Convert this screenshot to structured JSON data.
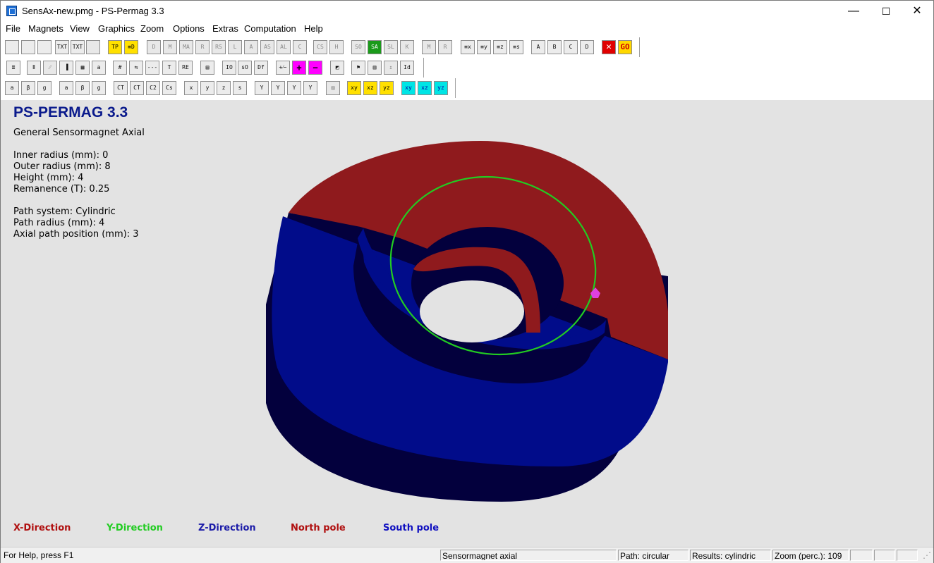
{
  "window": {
    "title": "SensAx-new.pmg - PS-Permag 3.3",
    "minimize": "—",
    "maximize": "☐",
    "close": "✕"
  },
  "menu": [
    "File",
    "Magnets",
    "View",
    "Graphics",
    "Zoom",
    "Options",
    "Extras",
    "Computation",
    "Help"
  ],
  "toolbar": {
    "row1": [
      {
        "name": "new-file-button",
        "label": "",
        "icon": "new-document-icon"
      },
      {
        "name": "open-file-button",
        "label": "",
        "icon": "open-folder-icon"
      },
      {
        "name": "save-file-button",
        "label": "",
        "icon": "floppy-disk-icon"
      },
      {
        "name": "export-txt-button",
        "label": "TXT"
      },
      {
        "name": "export-txt-graph-button",
        "label": "TXT"
      },
      {
        "name": "print-button",
        "label": "",
        "icon": "printer-icon"
      },
      {
        "name": "tp-button",
        "label": "TP"
      },
      {
        "name": "yellow-list-button",
        "label": "≡D"
      },
      {
        "name": "3d-d-button",
        "label": "D"
      },
      {
        "name": "3d-m-button",
        "label": "M"
      },
      {
        "name": "3d-ma-button",
        "label": "MA"
      },
      {
        "name": "3d-r-button",
        "label": "R"
      },
      {
        "name": "3d-rs-button",
        "label": "RS"
      },
      {
        "name": "3d-l-button",
        "label": "L"
      },
      {
        "name": "3d-a-button",
        "label": "A"
      },
      {
        "name": "3d-as-button",
        "label": "AS"
      },
      {
        "name": "3d-al-button",
        "label": "AL"
      },
      {
        "name": "3d-c-button",
        "label": "C"
      },
      {
        "name": "3d-cs-button",
        "label": "CS"
      },
      {
        "name": "3d-h-button",
        "label": "H"
      },
      {
        "name": "3d-so-button",
        "label": "SO"
      },
      {
        "name": "3d-sa-button",
        "label": "SA"
      },
      {
        "name": "3d-sl-button",
        "label": "SL"
      },
      {
        "name": "3d-k-button",
        "label": "K"
      },
      {
        "name": "3d-m2-button",
        "label": "M"
      },
      {
        "name": "3d-r2-button",
        "label": "R"
      },
      {
        "name": "sort-x-button",
        "label": "≡x"
      },
      {
        "name": "sort-y-button",
        "label": "≡y"
      },
      {
        "name": "sort-z-button",
        "label": "≡z"
      },
      {
        "name": "sort-s-button",
        "label": "≡s"
      },
      {
        "name": "view-a-button",
        "label": "A"
      },
      {
        "name": "view-b-button",
        "label": "B"
      },
      {
        "name": "view-c-button",
        "label": "C"
      },
      {
        "name": "view-d-button",
        "label": "D"
      },
      {
        "name": "stop-button",
        "label": "✕"
      },
      {
        "name": "go-button",
        "label": "GO"
      }
    ],
    "row2": [
      {
        "name": "colors-button",
        "label": "≣"
      },
      {
        "name": "tool-b-button",
        "label": "Ⅱ"
      },
      {
        "name": "tool-c-button",
        "label": "⁄⁄"
      },
      {
        "name": "bars-button",
        "label": "▐"
      },
      {
        "name": "palette-button",
        "label": "▦"
      },
      {
        "name": "text-a-button",
        "label": "a"
      },
      {
        "name": "grid-button",
        "label": "#"
      },
      {
        "name": "swap-button",
        "label": "⇆"
      },
      {
        "name": "dash-button",
        "label": "---"
      },
      {
        "name": "t-button",
        "label": "T"
      },
      {
        "name": "red-field-button",
        "label": "RE"
      },
      {
        "name": "table-button",
        "label": "▤"
      },
      {
        "name": "io-button",
        "label": "IO"
      },
      {
        "name": "so-button",
        "label": "sO"
      },
      {
        "name": "df-button",
        "label": "Df"
      },
      {
        "name": "plus-minus-button",
        "label": "+⁄−"
      },
      {
        "name": "plus-button",
        "label": "+"
      },
      {
        "name": "minus-button",
        "label": "−"
      },
      {
        "name": "diagonal-button",
        "label": "◩"
      },
      {
        "name": "flag-button",
        "label": "⚑"
      },
      {
        "name": "columns-button",
        "label": "▥"
      },
      {
        "name": "upload-button",
        "label": "↥"
      },
      {
        "name": "id-button",
        "label": "Id"
      }
    ],
    "row3": [
      {
        "name": "a-box-button",
        "label": "a"
      },
      {
        "name": "b-box-button",
        "label": "β"
      },
      {
        "name": "g-box-button",
        "label": "g"
      },
      {
        "name": "a-graph-button",
        "label": "a"
      },
      {
        "name": "b-graph-button",
        "label": "β"
      },
      {
        "name": "g-graph-button",
        "label": "g"
      },
      {
        "name": "ct-button",
        "label": "CT"
      },
      {
        "name": "ct2-button",
        "label": "CT"
      },
      {
        "name": "c2-button",
        "label": "C2"
      },
      {
        "name": "cs-button",
        "label": "Cs"
      },
      {
        "name": "bar-x-button",
        "label": "x"
      },
      {
        "name": "bar-y-button",
        "label": "y"
      },
      {
        "name": "bar-z-button",
        "label": "z"
      },
      {
        "name": "bar-s-button",
        "label": "s"
      },
      {
        "name": "y-x-button",
        "label": "Y"
      },
      {
        "name": "y-y-button",
        "label": "Y"
      },
      {
        "name": "y-z-button",
        "label": "Y"
      },
      {
        "name": "y-s-button",
        "label": "Y"
      },
      {
        "name": "picture-button",
        "label": "▨"
      },
      {
        "name": "xy-button",
        "label": "xy"
      },
      {
        "name": "xz-button",
        "label": "xz"
      },
      {
        "name": "yz-button",
        "label": "yz"
      },
      {
        "name": "cxy-button",
        "label": "xy"
      },
      {
        "name": "cxz-button",
        "label": "xz"
      },
      {
        "name": "cyz-button",
        "label": "yz"
      }
    ]
  },
  "main": {
    "heading": "PS-PERMAG 3.3",
    "subtitle": "General Sensormagnet Axial",
    "params": [
      "Inner radius (mm): 0",
      "Outer radius (mm): 8",
      "Height (mm): 4",
      "Remanence (T): 0.25"
    ],
    "path": [
      "Path system: Cylindric",
      "Path radius (mm): 4",
      "Axial path position (mm): 3"
    ],
    "legend": [
      {
        "label": "X-Direction",
        "color": "#b01010"
      },
      {
        "label": "Y-Direction",
        "color": "#22cc22"
      },
      {
        "label": "Z-Direction",
        "color": "#1b1ba8"
      },
      {
        "label": "North pole",
        "color": "#b01010"
      },
      {
        "label": "South pole",
        "color": "#1010c0"
      }
    ],
    "colors": {
      "north": "#8f1a1d",
      "south": "#010c8a",
      "side": "#03003d",
      "path": "#22cc22",
      "marker": "#e040e0"
    }
  },
  "status": {
    "help": "For Help, press F1",
    "magnet": "Sensormagnet axial",
    "path": "Path: circular",
    "results": "Results: cylindric",
    "zoom": "Zoom (perc.): 109"
  }
}
